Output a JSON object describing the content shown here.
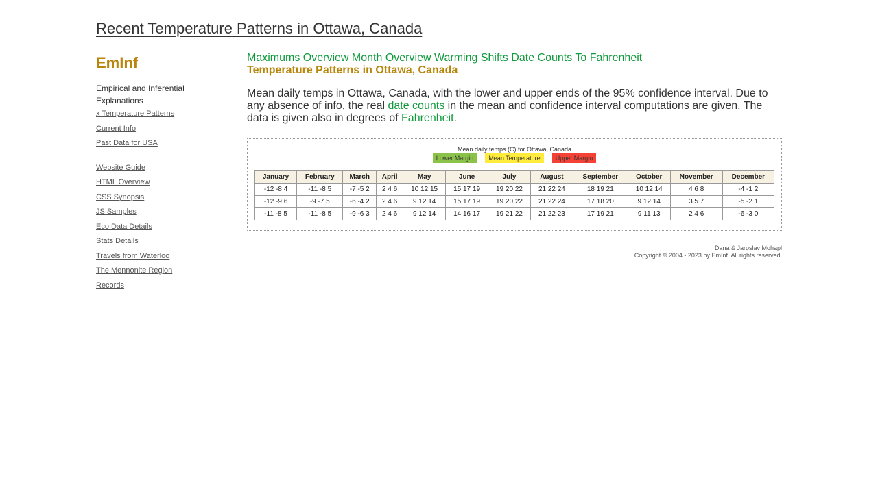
{
  "header": {
    "title": "Recent Temperature Patterns in Ottawa, Canada"
  },
  "sidebar": {
    "brand": "EmInf",
    "tagline": "Empirical and Inferential Explanations",
    "links_group1": [
      "x Temperature Patterns",
      "Current Info",
      "Past Data for USA"
    ],
    "links_group2": [
      "Website Guide",
      "HTML Overview",
      "CSS Synopsis",
      "JS Samples",
      "Eco Data Details",
      "Stats Details",
      "Travels from Waterloo",
      "The Mennonite Region",
      "Records"
    ]
  },
  "nav": {
    "links": [
      "Maximums Overview",
      "Month Overview",
      "Warming Shifts",
      "Date Counts",
      "To Fahrenheit"
    ]
  },
  "main": {
    "subtitle": "Temperature Patterns in Ottawa, Canada",
    "intro_part1": "Mean daily temps in Ottawa, Canada, with the lower and upper ends of the 95% confidence interval. Due to any absence of info, the real ",
    "intro_link1": "date counts",
    "intro_part2": " in the mean and confidence interval computations are given. The data is given also in degrees of ",
    "intro_link2": "Fahrenheit",
    "intro_part3": "."
  },
  "chart_data": {
    "type": "table",
    "title": "Mean daily temps (C) for Ottawa, Canada",
    "legend": [
      {
        "label": "Lower Margin",
        "color": "#8bc34a"
      },
      {
        "label": "Mean Temperature",
        "color": "#ffeb3b"
      },
      {
        "label": "Upper Margin",
        "color": "#f44336"
      }
    ],
    "columns": [
      "January",
      "February",
      "March",
      "April",
      "May",
      "June",
      "July",
      "August",
      "September",
      "October",
      "November",
      "December"
    ],
    "rows": [
      [
        "-12 -8 4",
        "-11 -8 5",
        "-7 -5 2",
        "2 4 6",
        "10 12 15",
        "15 17 19",
        "19 20 22",
        "21 22 24",
        "18 19 21",
        "10 12 14",
        "4 6 8",
        "-4 -1 2"
      ],
      [
        "-12 -9 6",
        "-9 -7 5",
        "-6 -4 2",
        "2 4 6",
        "9 12 14",
        "15 17 19",
        "19 20 22",
        "21 22 24",
        "17 18 20",
        "9 12 14",
        "3 5 7",
        "-5 -2 1"
      ],
      [
        "-11 -8 5",
        "-11 -8 5",
        "-9 -6 3",
        "2 4 6",
        "9 12 14",
        "14 16 17",
        "19 21 22",
        "21 22 23",
        "17 19 21",
        "9 11 13",
        "2 4 6",
        "-6 -3 0"
      ]
    ]
  },
  "footer": {
    "authors": "Dana & Jaroslav Mohapl",
    "copyright": "Copyright © 2004 - 2023 by EmInf. All rights reserved."
  }
}
